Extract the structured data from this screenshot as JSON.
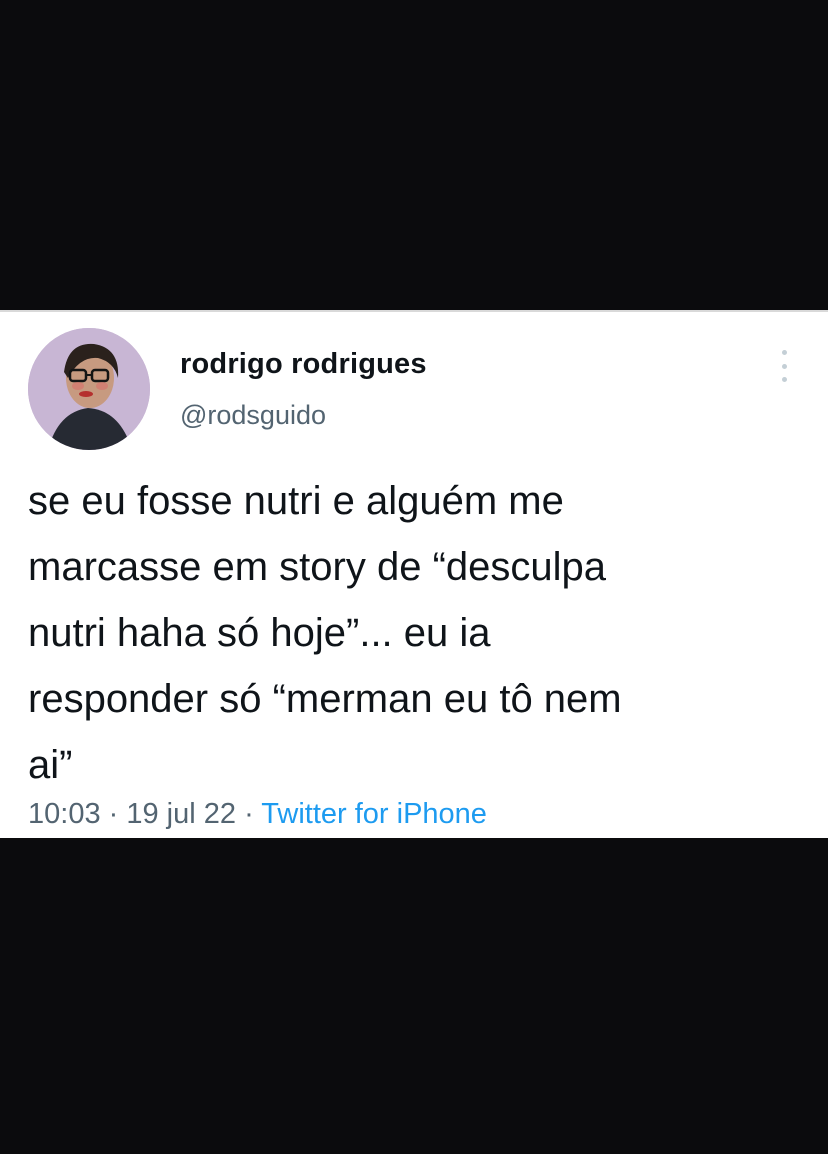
{
  "tweet": {
    "display_name": "rodrigo rodrigues",
    "handle": "@rodsguido",
    "text_lines": [
      "se eu fosse nutri e alguém me",
      "marcasse em story de “desculpa",
      "nutri haha só hoje”... eu ia",
      "responder só “merman eu tô nem",
      "ai”"
    ],
    "time": "10:03",
    "date": "19 jul 22",
    "separator": "·",
    "source": "Twitter for iPhone"
  },
  "icons": {
    "avatar": "profile-photo",
    "more": "more-vertical-icon"
  },
  "colors": {
    "background_band": "#0b0b0d",
    "card": "#ffffff",
    "text": "#0f1419",
    "secondary": "#536471",
    "link": "#1d9bf0"
  }
}
